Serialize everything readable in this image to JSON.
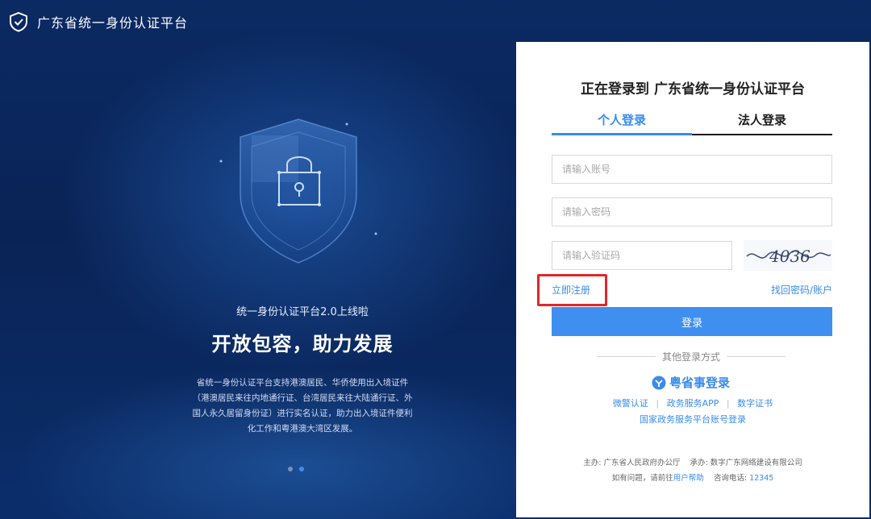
{
  "header": {
    "title": "广东省统一身份认证平台"
  },
  "hero": {
    "subtitle": "统一身份认证平台2.0上线啦",
    "headline": "开放包容，助力发展",
    "description_lines": [
      "省统一身份认证平台支持港澳居民、华侨使用出入境证件",
      "（港澳居民来往内地通行证、台湾居民来往大陆通行证、外",
      "国人永久居留身份证）进行实名认证，助力出入境证件便利",
      "化工作和粤港澳大湾区发展。"
    ]
  },
  "carousel": {
    "dot_colors": [
      "#7f8fb0",
      "#3d8ff0"
    ]
  },
  "panel": {
    "title": "正在登录到 广东省统一身份认证平台",
    "tabs": [
      {
        "label": "个人登录",
        "active": true
      },
      {
        "label": "法人登录",
        "active": false
      }
    ],
    "account_placeholder": "请输入账号",
    "password_placeholder": "请输入密码",
    "captcha_placeholder": "请输入验证码",
    "captcha_text": "4036",
    "register_link": "立即注册",
    "forgot_link": "找回密码/账户",
    "login_button": "登录",
    "other_methods_label": "其他登录方式",
    "yss_label": "粤省事登录",
    "methods": [
      "微警认证",
      "政务服务APP",
      "数字证书"
    ],
    "method_separator": "|",
    "national_link": "国家政务服务平台账号登录",
    "footer": {
      "sponsor_label": "主办:",
      "sponsor": "广东省人民政府办公厅",
      "undertaker_label": "承办:",
      "undertaker": "数字广东网络建设有限公司",
      "help_prefix": "如有问题，请前往",
      "help_link": "用户帮助",
      "hotline_label": "咨询电话:",
      "hotline": "12345"
    }
  },
  "colors": {
    "accent": "#3a8bef",
    "highlight": "#e1262b",
    "background": "#0a2456"
  }
}
